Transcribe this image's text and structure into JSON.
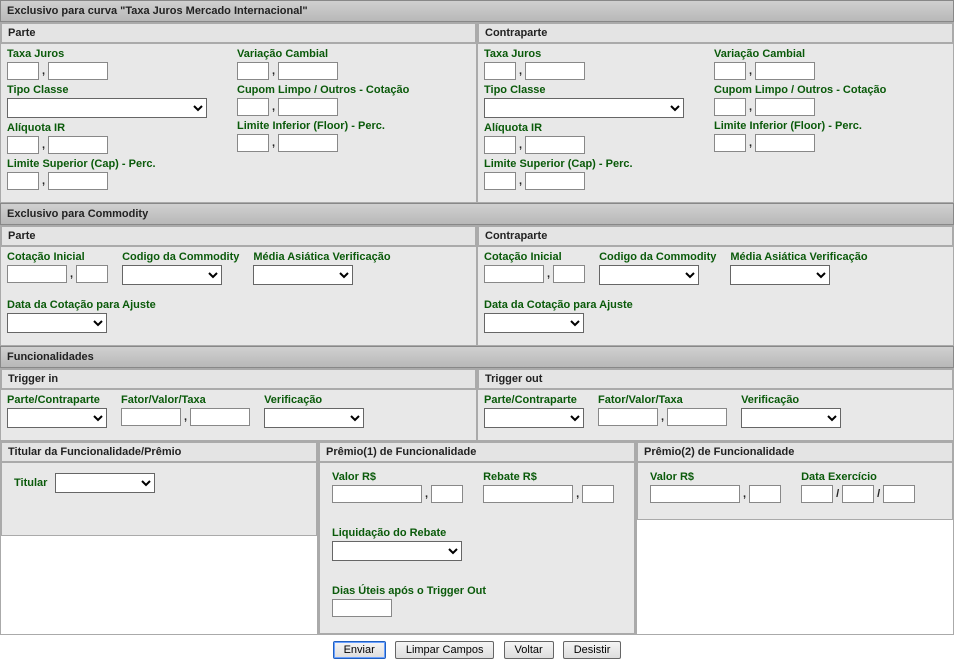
{
  "s1": {
    "title": "Exclusivo para curva \"Taxa Juros Mercado Internacional\"",
    "parte": {
      "title": "Parte",
      "taxa": "Taxa Juros",
      "varcamb": "Variação Cambial",
      "tipoclasse": "Tipo Classe",
      "cupom": "Cupom Limpo / Outros - Cotação",
      "aliquota": "Alíquota IR",
      "floor": "Limite Inferior (Floor) - Perc.",
      "cap": "Limite Superior (Cap) - Perc."
    },
    "contraparte": {
      "title": "Contraparte",
      "taxa": "Taxa Juros",
      "varcamb": "Variação Cambial",
      "tipoclasse": "Tipo Classe",
      "cupom": "Cupom Limpo / Outros - Cotação",
      "aliquota": "Alíquota IR",
      "floor": "Limite Inferior (Floor) - Perc.",
      "cap": "Limite Superior (Cap) - Perc."
    }
  },
  "s2": {
    "title": "Exclusivo para Commodity",
    "parte": {
      "title": "Parte",
      "cot": "Cotação Inicial",
      "cod": "Codigo da Commodity",
      "media": "Média Asiática Verificação",
      "data": "Data da Cotação para Ajuste"
    },
    "contraparte": {
      "title": "Contraparte",
      "cot": "Cotação Inicial",
      "cod": "Codigo da Commodity",
      "media": "Média Asiática Verificação",
      "data": "Data da Cotação para Ajuste"
    }
  },
  "s3": {
    "title": "Funcionalidades",
    "trigin": {
      "title": "Trigger in",
      "pc": "Parte/Contraparte",
      "fvt": "Fator/Valor/Taxa",
      "ver": "Verificação"
    },
    "trigout": {
      "title": "Trigger out",
      "pc": "Parte/Contraparte",
      "fvt": "Fator/Valor/Taxa",
      "ver": "Verificação"
    }
  },
  "s4": {
    "t1": {
      "title": "Titular da Funcionalidade/Prêmio",
      "tit": "Titular"
    },
    "p1": {
      "title": "Prêmio(1) de Funcionalidade",
      "valor": "Valor R$",
      "rebate": "Rebate R$",
      "liq": "Liquidação do Rebate",
      "dias": "Dias Úteis após o Trigger Out"
    },
    "p2": {
      "title": "Prêmio(2) de Funcionalidade",
      "valor": "Valor R$",
      "data": "Data Exercício"
    }
  },
  "buttons": {
    "enviar": "Enviar",
    "limpar": "Limpar Campos",
    "voltar": "Voltar",
    "desistir": "Desistir"
  },
  "glyph": {
    "comma": ",",
    "slash": "/"
  }
}
